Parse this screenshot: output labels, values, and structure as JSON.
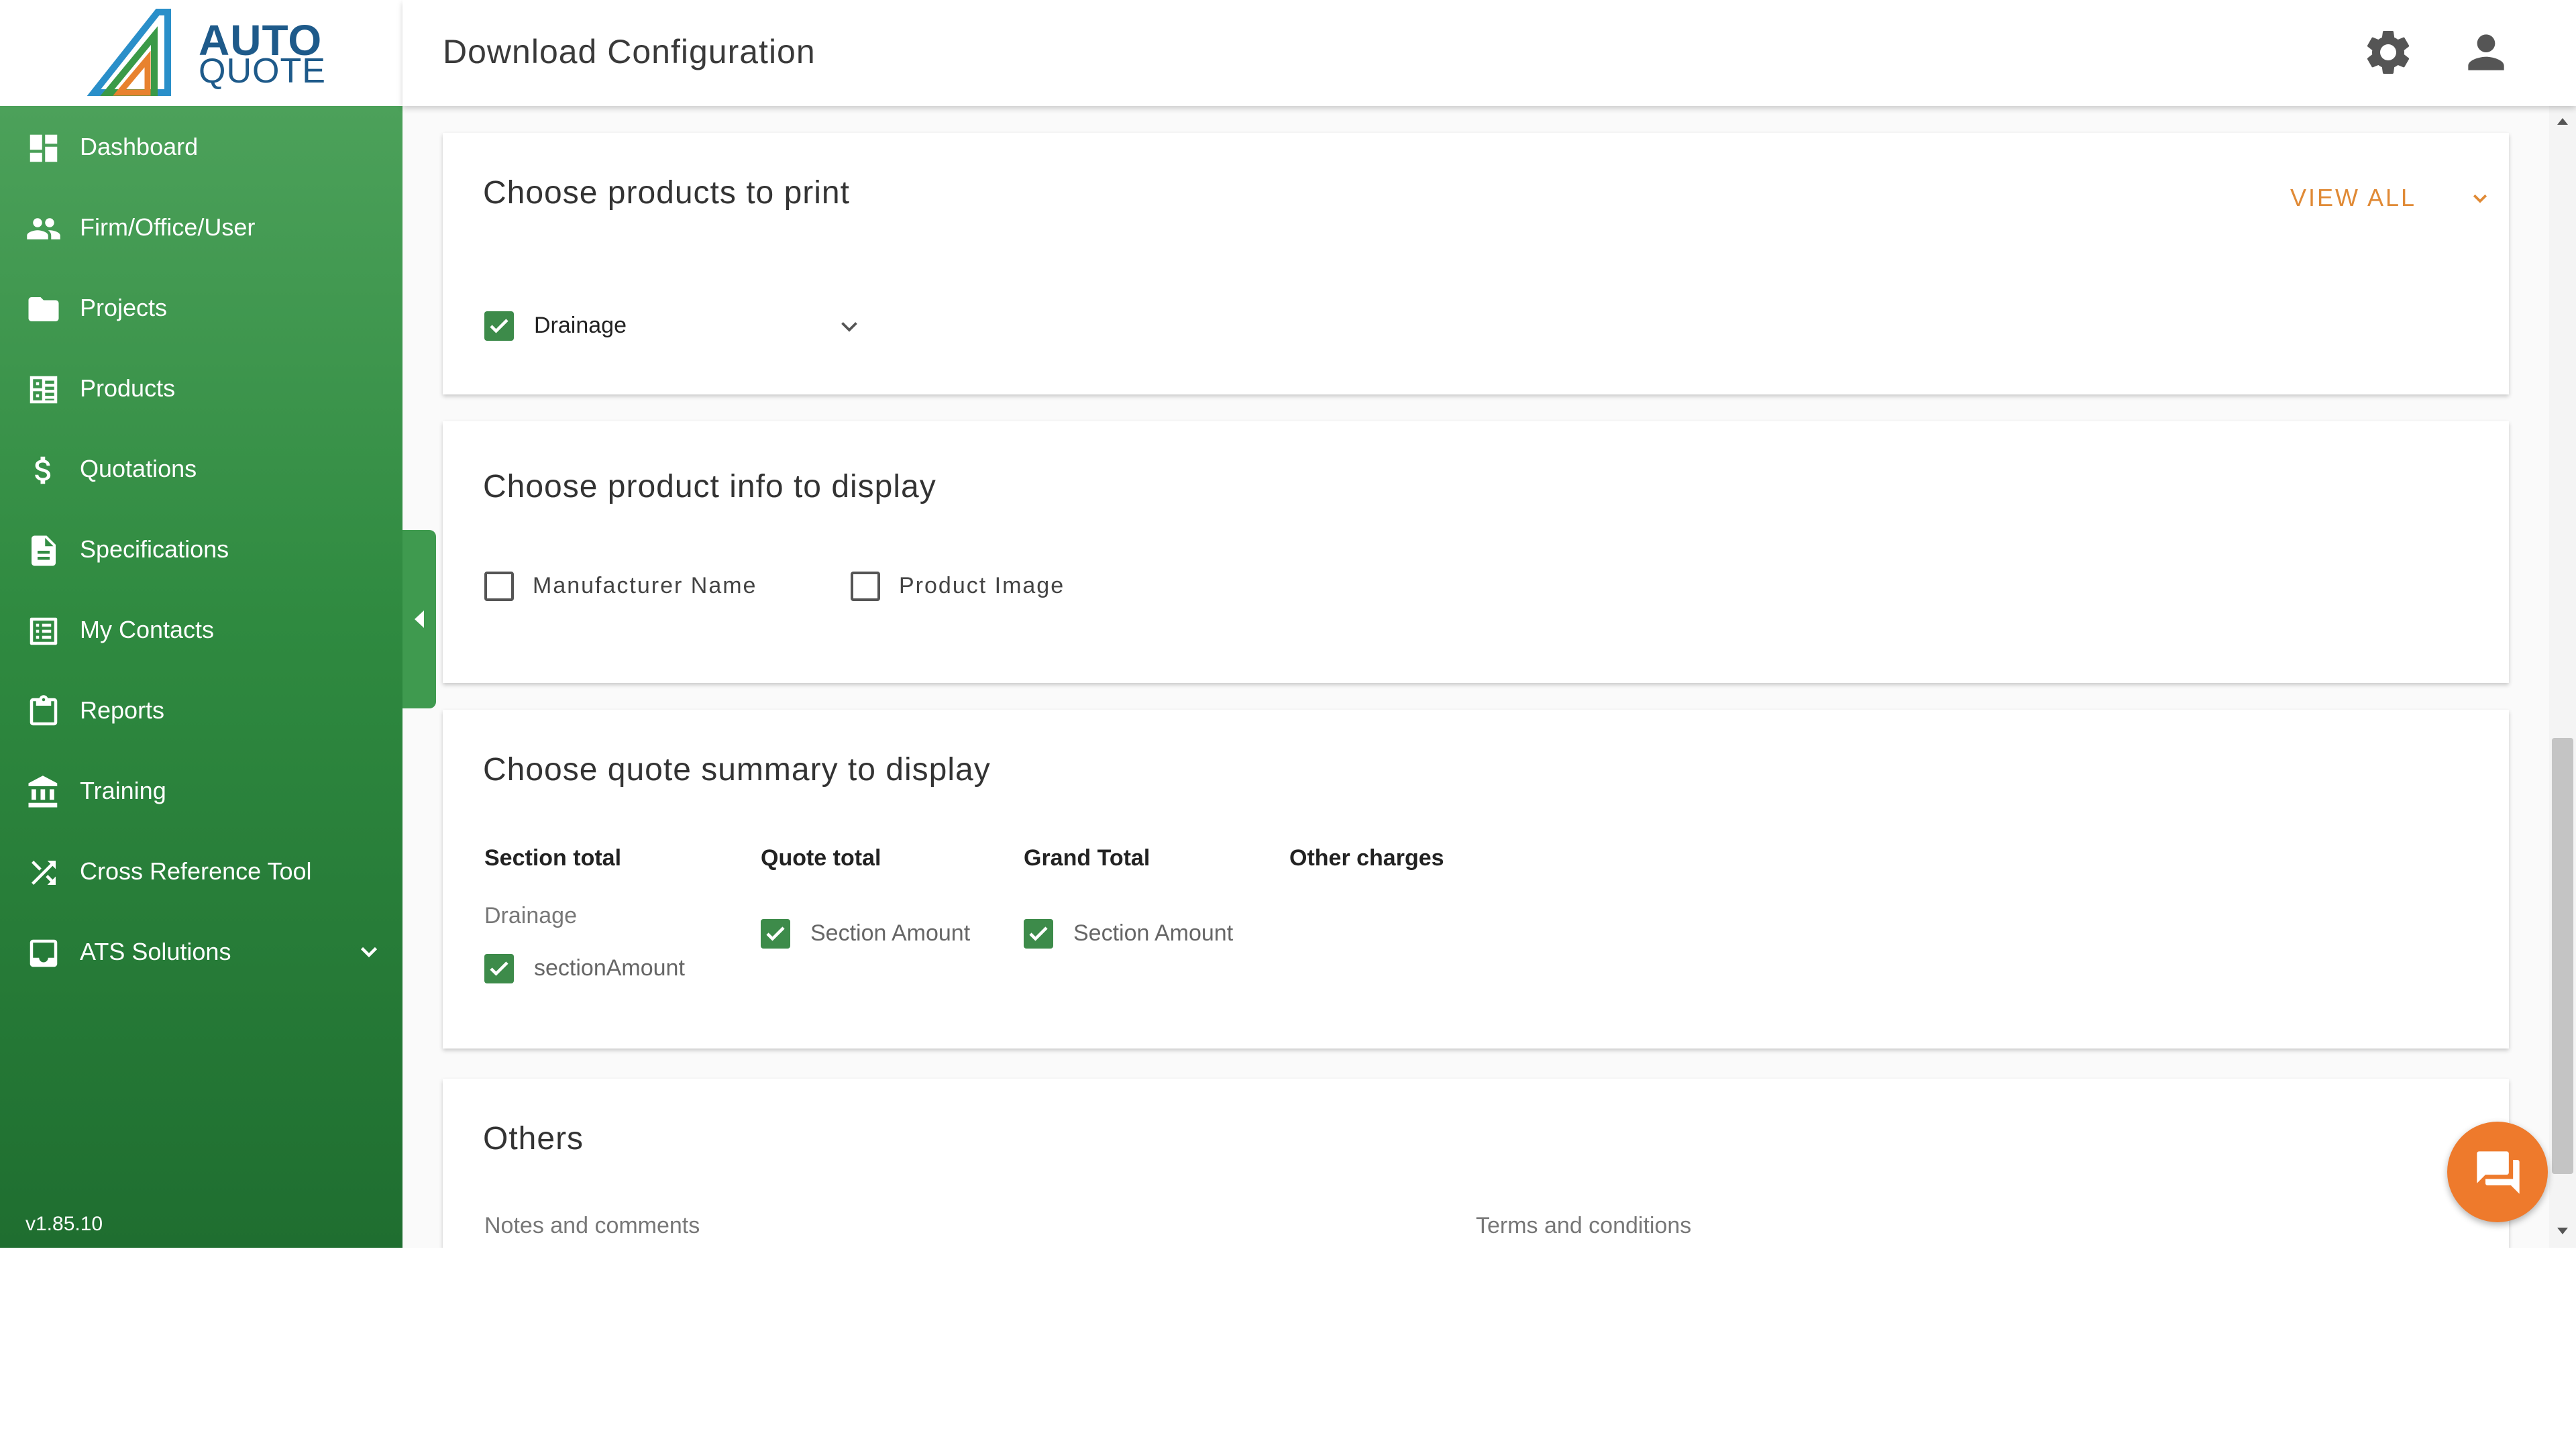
{
  "brand": {
    "line1": "AUTO",
    "line2": "QUOTE"
  },
  "header": {
    "title": "Download Configuration"
  },
  "sidebar": {
    "items": [
      {
        "label": "Dashboard",
        "icon": "dashboard-icon"
      },
      {
        "label": "Firm/Office/User",
        "icon": "people-icon"
      },
      {
        "label": "Projects",
        "icon": "folder-icon"
      },
      {
        "label": "Products",
        "icon": "products-icon"
      },
      {
        "label": "Quotations",
        "icon": "dollar-icon"
      },
      {
        "label": "Specifications",
        "icon": "document-icon"
      },
      {
        "label": "My Contacts",
        "icon": "list-icon"
      },
      {
        "label": "Reports",
        "icon": "clipboard-icon"
      },
      {
        "label": "Training",
        "icon": "institution-icon"
      },
      {
        "label": "Cross Reference Tool",
        "icon": "shuffle-icon"
      },
      {
        "label": "ATS Solutions",
        "icon": "inbox-icon"
      }
    ],
    "version": "v1.85.10"
  },
  "products_card": {
    "title": "Choose products to print",
    "view_all": "VIEW ALL",
    "item": {
      "label": "Drainage",
      "checked": true
    }
  },
  "info_card": {
    "title": "Choose product info to display",
    "options": [
      {
        "label": "Manufacturer Name",
        "checked": false
      },
      {
        "label": "Product Image",
        "checked": false
      }
    ]
  },
  "summary_card": {
    "title": "Choose quote summary to display",
    "columns": [
      {
        "header": "Section total",
        "sub": "Drainage",
        "option": "sectionAmount",
        "checked": true
      },
      {
        "header": "Quote total",
        "option": "Section Amount",
        "checked": true
      },
      {
        "header": "Grand Total",
        "option": "Section Amount",
        "checked": true
      },
      {
        "header": "Other charges"
      }
    ]
  },
  "others_card": {
    "title": "Others",
    "notes_label": "Notes and comments",
    "terms_label": "Terms and conditions"
  },
  "colors": {
    "brand_green": "#3d8b4a",
    "accent_orange": "#ee7a2c",
    "logo_blue": "#1e5a8a"
  }
}
